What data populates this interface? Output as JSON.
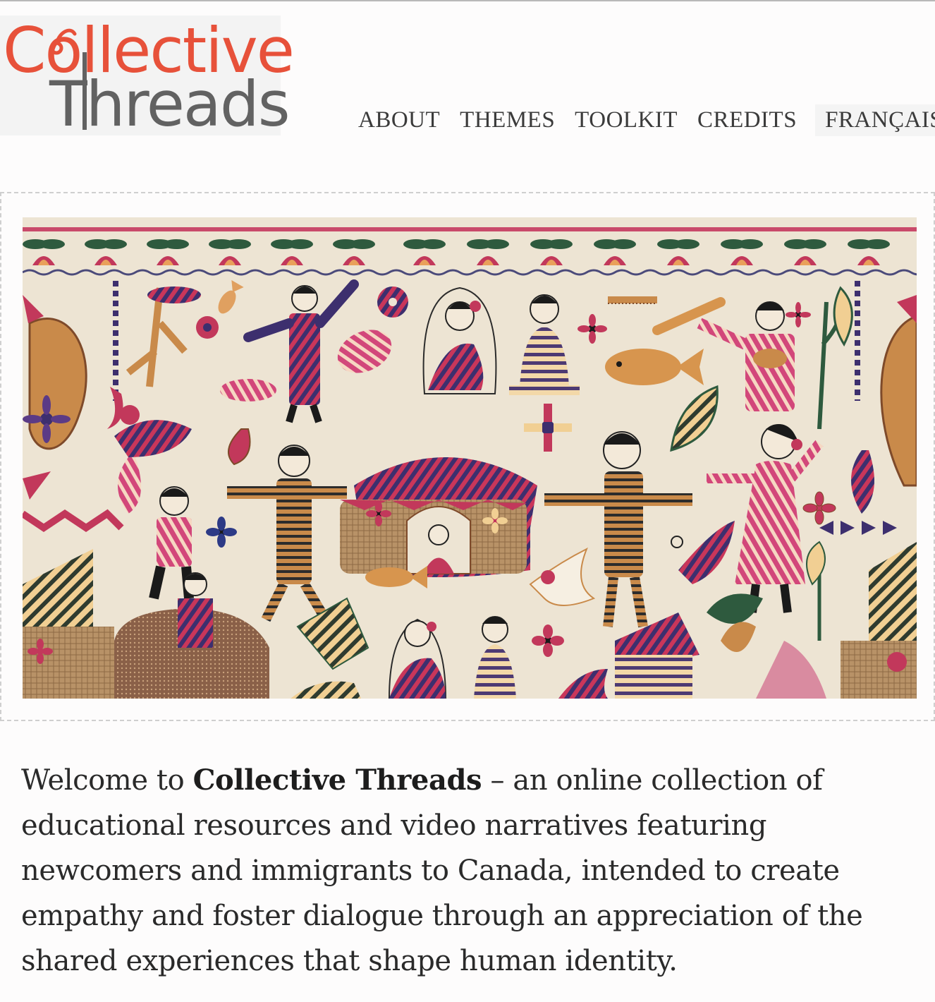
{
  "logo": {
    "line1": "Collective",
    "line2": "Threads"
  },
  "nav": {
    "items": [
      {
        "label": "ABOUT"
      },
      {
        "label": "THEMES"
      },
      {
        "label": "TOOLKIT"
      },
      {
        "label": "CREDITS"
      },
      {
        "label": "FRANÇAIS"
      }
    ]
  },
  "hero": {
    "image": "embroidered kantha textile with figures, birds, fish and huts"
  },
  "intro": {
    "lead": "Welcome to ",
    "brand": "Collective Threads",
    "rest": " – an online collection of educational resources and video narratives featuring newcomers and immigrants to Canada, intended to create empathy and foster dialogue through an appreciation of the shared experiences that shape human identity."
  },
  "colors": {
    "logo_red": "#e7513a",
    "logo_orange": "#f4a535",
    "logo_grey": "#626262",
    "nav_text": "#3b3b3b",
    "textile_base": "#ede4d3"
  }
}
